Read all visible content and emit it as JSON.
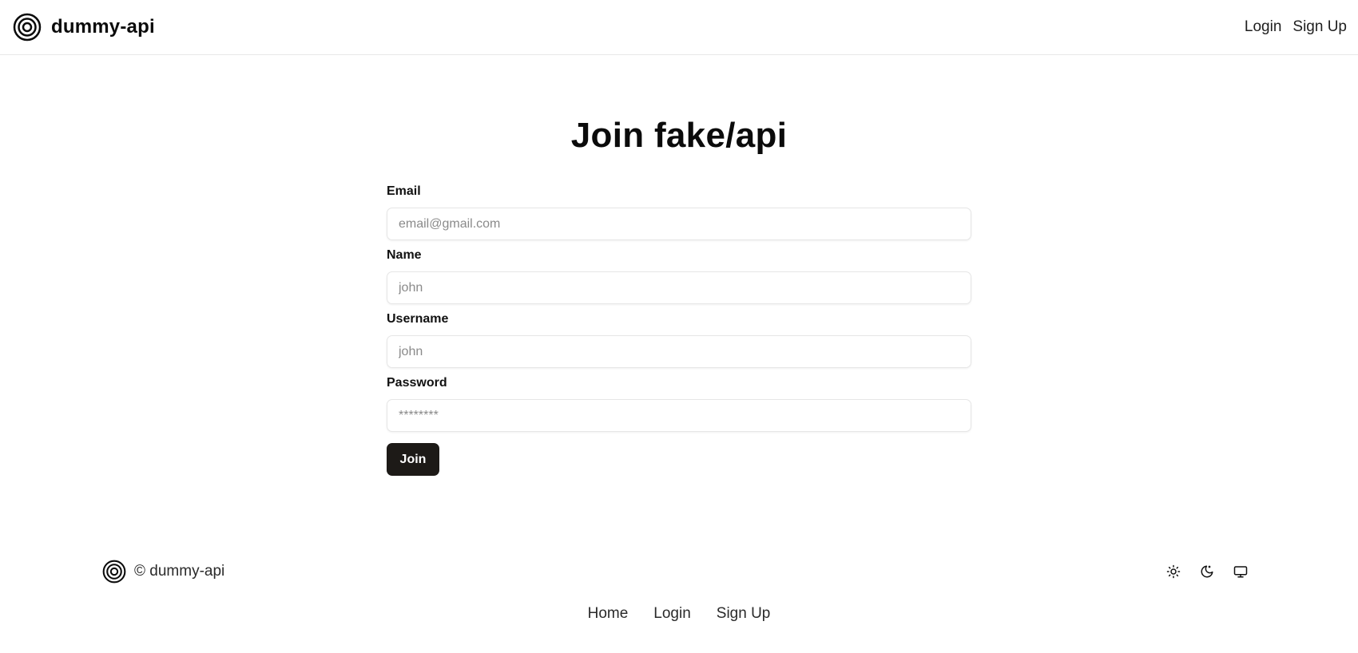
{
  "header": {
    "brand_name": "dummy-api",
    "nav": {
      "login": "Login",
      "signup": "Sign Up"
    }
  },
  "main": {
    "title": "Join fake/api",
    "fields": {
      "email": {
        "label": "Email",
        "placeholder": "email@gmail.com"
      },
      "name": {
        "label": "Name",
        "placeholder": "john"
      },
      "username": {
        "label": "Username",
        "placeholder": "john"
      },
      "password": {
        "label": "Password",
        "placeholder": "********"
      }
    },
    "submit_label": "Join"
  },
  "footer": {
    "copyright": "© dummy-api",
    "theme_icons": [
      "sun-icon",
      "moon-icon",
      "monitor-icon"
    ],
    "links": {
      "home": "Home",
      "login": "Login",
      "signup": "Sign Up"
    }
  }
}
